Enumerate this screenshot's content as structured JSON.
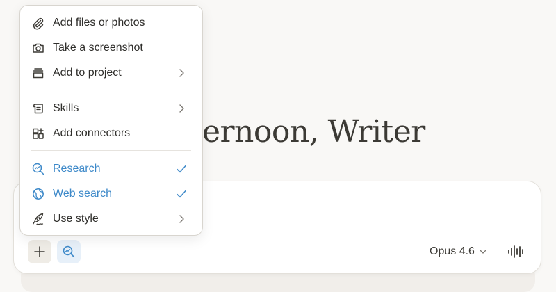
{
  "greeting": {
    "text": "fternoon, Writer"
  },
  "composer": {
    "model_label": "Opus 4.6"
  },
  "icons": {
    "plus": "plus-icon",
    "research": "research-icon",
    "chevron": "chevron-down-icon",
    "voice": "voice-waveform-icon"
  },
  "menu": {
    "items": [
      {
        "label": "Add files or photos",
        "icon": "paperclip-icon"
      },
      {
        "label": "Take a screenshot",
        "icon": "camera-icon"
      },
      {
        "label": "Add to project",
        "icon": "project-box-icon",
        "submenu": true
      },
      {
        "label": "Skills",
        "icon": "scroll-icon",
        "submenu": true
      },
      {
        "label": "Add connectors",
        "icon": "connectors-icon"
      },
      {
        "label": "Research",
        "icon": "research-icon",
        "checked": true
      },
      {
        "label": "Web search",
        "icon": "globe-icon",
        "checked": true
      },
      {
        "label": "Use style",
        "icon": "quill-icon",
        "submenu": true
      }
    ]
  },
  "colors": {
    "accent": "#3d89c9",
    "background": "#f9f8f6",
    "text": "#2f2e2b"
  }
}
